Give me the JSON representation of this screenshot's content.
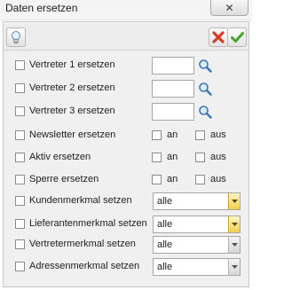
{
  "window": {
    "title": "Daten ersetzen",
    "close_symbol": "✕"
  },
  "toolbar": {
    "help_icon": "lightbulb-icon",
    "cancel_icon": "red-x-icon",
    "ok_icon": "green-check-icon"
  },
  "rows": [
    {
      "label": "Vertreter 1 ersetzen"
    },
    {
      "label": "Vertreter 2 ersetzen"
    },
    {
      "label": "Vertreter 3 ersetzen"
    },
    {
      "label": "Newsletter ersetzen",
      "on_label": "an",
      "off_label": "aus"
    },
    {
      "label": "Aktiv ersetzen",
      "on_label": "an",
      "off_label": "aus"
    },
    {
      "label": "Sperre ersetzen",
      "on_label": "an",
      "off_label": "aus"
    },
    {
      "label": "Kundenmerkmal setzen",
      "value": "alle"
    },
    {
      "label": "Lieferantenmerkmal setzen",
      "value": "alle"
    },
    {
      "label": "Vertretermerkmal setzen",
      "value": "alle"
    },
    {
      "label": "Adressenmerkmal setzen",
      "value": "alle"
    }
  ],
  "colors": {
    "active_dropdown": "#f1cf4a",
    "cancel": "#d93a22",
    "ok": "#3fa62a"
  }
}
